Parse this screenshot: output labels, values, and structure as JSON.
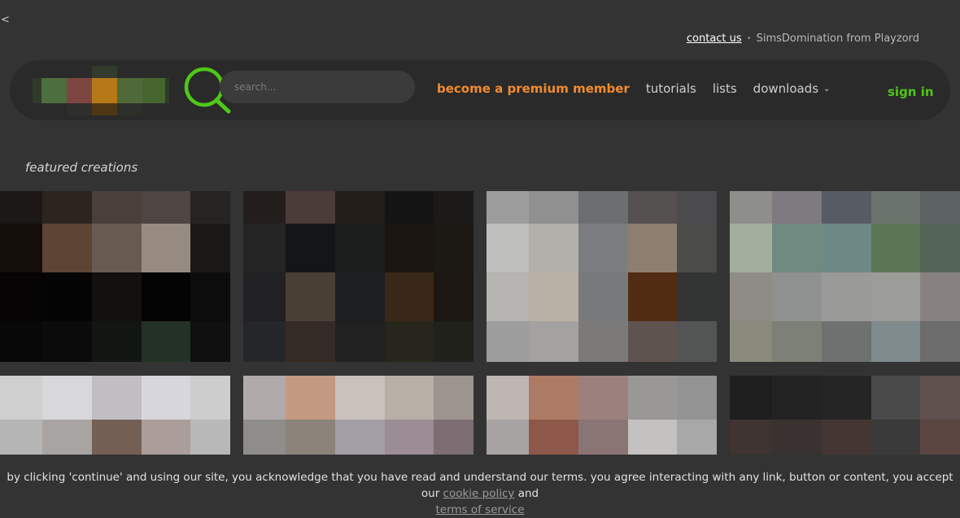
{
  "back_label": "<",
  "top_links": {
    "contact": "contact us",
    "separator": "•",
    "brand": "SimsDomination from Playzord"
  },
  "search": {
    "placeholder": "search..."
  },
  "nav": {
    "premium": "become a premium member",
    "tutorials": "tutorials",
    "lists": "lists",
    "downloads": "downloads",
    "downloads_icon": "chevron-down-icon"
  },
  "signin": "sign in",
  "section_title": "featured creations",
  "colors": {
    "accent_green": "#4ec818",
    "premium_orange": "#f28b2f",
    "background": "#333333",
    "navbar": "#2a2a2a"
  },
  "cookie": {
    "text": "by clicking 'continue' and using our site, you acknowledge that you have read and understand our terms. you agree interacting with any link, button or content, you accept our",
    "cookie_link": "cookie policy",
    "and": "and",
    "tos_link": "terms of service"
  }
}
